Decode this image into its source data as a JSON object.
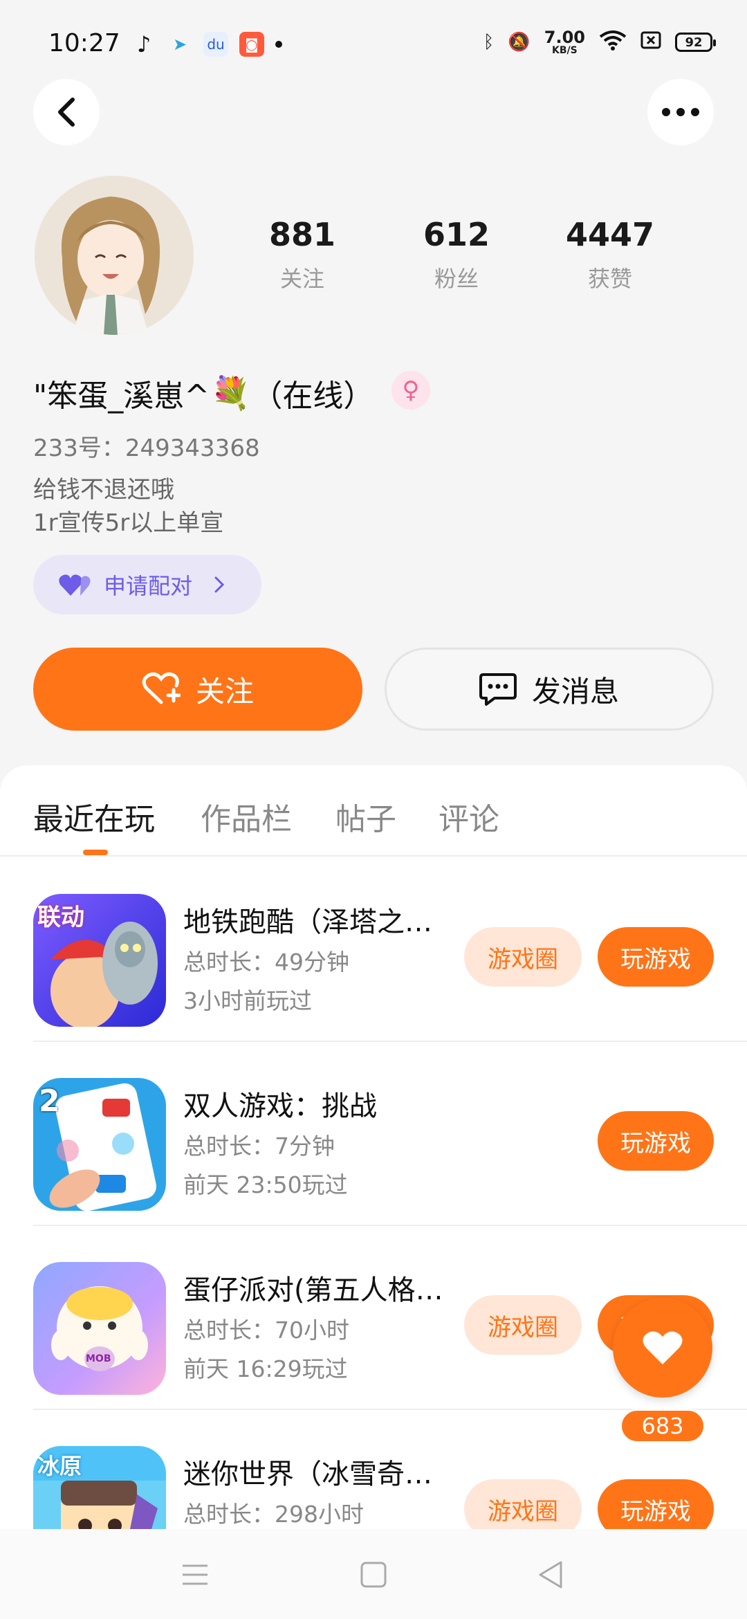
{
  "status_bar": {
    "time": "10:27",
    "speed_value": "7.00",
    "speed_unit": "KB/S",
    "battery": "92"
  },
  "profile": {
    "stats": [
      {
        "value": "881",
        "label": "关注"
      },
      {
        "value": "612",
        "label": "粉丝"
      },
      {
        "value": "4447",
        "label": "获赞"
      }
    ],
    "name_part1": "\"笨蛋_溪崽^",
    "name_part2": "（在线）",
    "gender_symbol": "♀",
    "account_id": "233号：249343368",
    "bio_line1": "给钱不退还哦",
    "bio_line2": "1r宣传5r以上单宣",
    "pair_label": "申请配对",
    "follow_label": "关注",
    "message_label": "发消息"
  },
  "tabs": [
    "最近在玩",
    "作品栏",
    "帖子",
    "评论"
  ],
  "games": [
    {
      "name": "地铁跑酷（泽塔之…",
      "duration": "总时长：49分钟",
      "last_played": "3小时前玩过",
      "circle_label": "游戏圈",
      "play_label": "玩游戏",
      "has_circle": true
    },
    {
      "name": "双人游戏：挑战",
      "duration": "总时长：7分钟",
      "last_played": "前天 23:50玩过",
      "play_label": "玩游戏",
      "has_circle": false
    },
    {
      "name": "蛋仔派对(第五人格…",
      "duration": "总时长：70小时",
      "last_played": "前天 16:29玩过",
      "circle_label": "游戏圈",
      "play_label": "玩游戏",
      "has_circle": true
    },
    {
      "name": "迷你世界（冰雪奇…",
      "duration": "总时长：298小时",
      "last_played": "",
      "circle_label": "游戏圈",
      "play_label": "玩游戏",
      "has_circle": true
    }
  ],
  "icon_badges": {
    "game1": "联动",
    "game2": "2",
    "game3": "MOB",
    "game4": "冰原"
  },
  "like_count": "683",
  "colors": {
    "accent": "#ff7417",
    "accent_soft": "#ffe6d6",
    "pair_purple": "#6c5ce7"
  }
}
